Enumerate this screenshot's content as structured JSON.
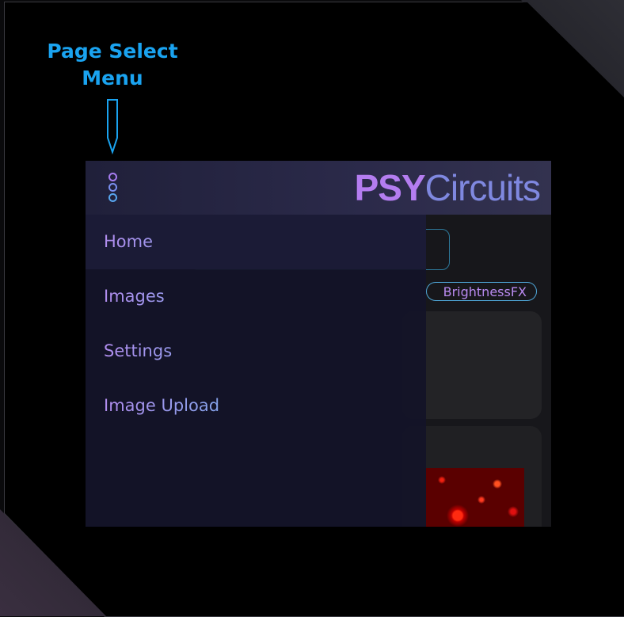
{
  "annotation": {
    "line1": "Page Select",
    "line2": "Menu"
  },
  "header": {
    "logo_bold": "PSY",
    "logo_light": "Circuits",
    "menu_icon": "kebab-menu-icon"
  },
  "background": {
    "chip_label": "BrightnessFX"
  },
  "drawer": {
    "items": [
      {
        "label": "Home"
      },
      {
        "label": "Images"
      },
      {
        "label": "Settings"
      },
      {
        "label": "Image Upload"
      }
    ]
  },
  "colors": {
    "accent_purple": "#b47df0",
    "accent_blue": "#1aa3f0",
    "drawer_bg": "#141428"
  }
}
